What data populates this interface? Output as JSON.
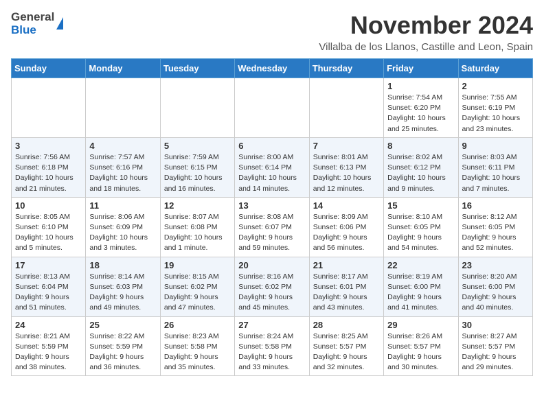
{
  "header": {
    "logo_general": "General",
    "logo_blue": "Blue",
    "title": "November 2024",
    "location": "Villalba de los Llanos, Castille and Leon, Spain"
  },
  "calendar": {
    "days_of_week": [
      "Sunday",
      "Monday",
      "Tuesday",
      "Wednesday",
      "Thursday",
      "Friday",
      "Saturday"
    ],
    "weeks": [
      [
        {
          "day": "",
          "info": ""
        },
        {
          "day": "",
          "info": ""
        },
        {
          "day": "",
          "info": ""
        },
        {
          "day": "",
          "info": ""
        },
        {
          "day": "",
          "info": ""
        },
        {
          "day": "1",
          "info": "Sunrise: 7:54 AM\nSunset: 6:20 PM\nDaylight: 10 hours\nand 25 minutes."
        },
        {
          "day": "2",
          "info": "Sunrise: 7:55 AM\nSunset: 6:19 PM\nDaylight: 10 hours\nand 23 minutes."
        }
      ],
      [
        {
          "day": "3",
          "info": "Sunrise: 7:56 AM\nSunset: 6:18 PM\nDaylight: 10 hours\nand 21 minutes."
        },
        {
          "day": "4",
          "info": "Sunrise: 7:57 AM\nSunset: 6:16 PM\nDaylight: 10 hours\nand 18 minutes."
        },
        {
          "day": "5",
          "info": "Sunrise: 7:59 AM\nSunset: 6:15 PM\nDaylight: 10 hours\nand 16 minutes."
        },
        {
          "day": "6",
          "info": "Sunrise: 8:00 AM\nSunset: 6:14 PM\nDaylight: 10 hours\nand 14 minutes."
        },
        {
          "day": "7",
          "info": "Sunrise: 8:01 AM\nSunset: 6:13 PM\nDaylight: 10 hours\nand 12 minutes."
        },
        {
          "day": "8",
          "info": "Sunrise: 8:02 AM\nSunset: 6:12 PM\nDaylight: 10 hours\nand 9 minutes."
        },
        {
          "day": "9",
          "info": "Sunrise: 8:03 AM\nSunset: 6:11 PM\nDaylight: 10 hours\nand 7 minutes."
        }
      ],
      [
        {
          "day": "10",
          "info": "Sunrise: 8:05 AM\nSunset: 6:10 PM\nDaylight: 10 hours\nand 5 minutes."
        },
        {
          "day": "11",
          "info": "Sunrise: 8:06 AM\nSunset: 6:09 PM\nDaylight: 10 hours\nand 3 minutes."
        },
        {
          "day": "12",
          "info": "Sunrise: 8:07 AM\nSunset: 6:08 PM\nDaylight: 10 hours\nand 1 minute."
        },
        {
          "day": "13",
          "info": "Sunrise: 8:08 AM\nSunset: 6:07 PM\nDaylight: 9 hours\nand 59 minutes."
        },
        {
          "day": "14",
          "info": "Sunrise: 8:09 AM\nSunset: 6:06 PM\nDaylight: 9 hours\nand 56 minutes."
        },
        {
          "day": "15",
          "info": "Sunrise: 8:10 AM\nSunset: 6:05 PM\nDaylight: 9 hours\nand 54 minutes."
        },
        {
          "day": "16",
          "info": "Sunrise: 8:12 AM\nSunset: 6:05 PM\nDaylight: 9 hours\nand 52 minutes."
        }
      ],
      [
        {
          "day": "17",
          "info": "Sunrise: 8:13 AM\nSunset: 6:04 PM\nDaylight: 9 hours\nand 51 minutes."
        },
        {
          "day": "18",
          "info": "Sunrise: 8:14 AM\nSunset: 6:03 PM\nDaylight: 9 hours\nand 49 minutes."
        },
        {
          "day": "19",
          "info": "Sunrise: 8:15 AM\nSunset: 6:02 PM\nDaylight: 9 hours\nand 47 minutes."
        },
        {
          "day": "20",
          "info": "Sunrise: 8:16 AM\nSunset: 6:02 PM\nDaylight: 9 hours\nand 45 minutes."
        },
        {
          "day": "21",
          "info": "Sunrise: 8:17 AM\nSunset: 6:01 PM\nDaylight: 9 hours\nand 43 minutes."
        },
        {
          "day": "22",
          "info": "Sunrise: 8:19 AM\nSunset: 6:00 PM\nDaylight: 9 hours\nand 41 minutes."
        },
        {
          "day": "23",
          "info": "Sunrise: 8:20 AM\nSunset: 6:00 PM\nDaylight: 9 hours\nand 40 minutes."
        }
      ],
      [
        {
          "day": "24",
          "info": "Sunrise: 8:21 AM\nSunset: 5:59 PM\nDaylight: 9 hours\nand 38 minutes."
        },
        {
          "day": "25",
          "info": "Sunrise: 8:22 AM\nSunset: 5:59 PM\nDaylight: 9 hours\nand 36 minutes."
        },
        {
          "day": "26",
          "info": "Sunrise: 8:23 AM\nSunset: 5:58 PM\nDaylight: 9 hours\nand 35 minutes."
        },
        {
          "day": "27",
          "info": "Sunrise: 8:24 AM\nSunset: 5:58 PM\nDaylight: 9 hours\nand 33 minutes."
        },
        {
          "day": "28",
          "info": "Sunrise: 8:25 AM\nSunset: 5:57 PM\nDaylight: 9 hours\nand 32 minutes."
        },
        {
          "day": "29",
          "info": "Sunrise: 8:26 AM\nSunset: 5:57 PM\nDaylight: 9 hours\nand 30 minutes."
        },
        {
          "day": "30",
          "info": "Sunrise: 8:27 AM\nSunset: 5:57 PM\nDaylight: 9 hours\nand 29 minutes."
        }
      ]
    ]
  }
}
